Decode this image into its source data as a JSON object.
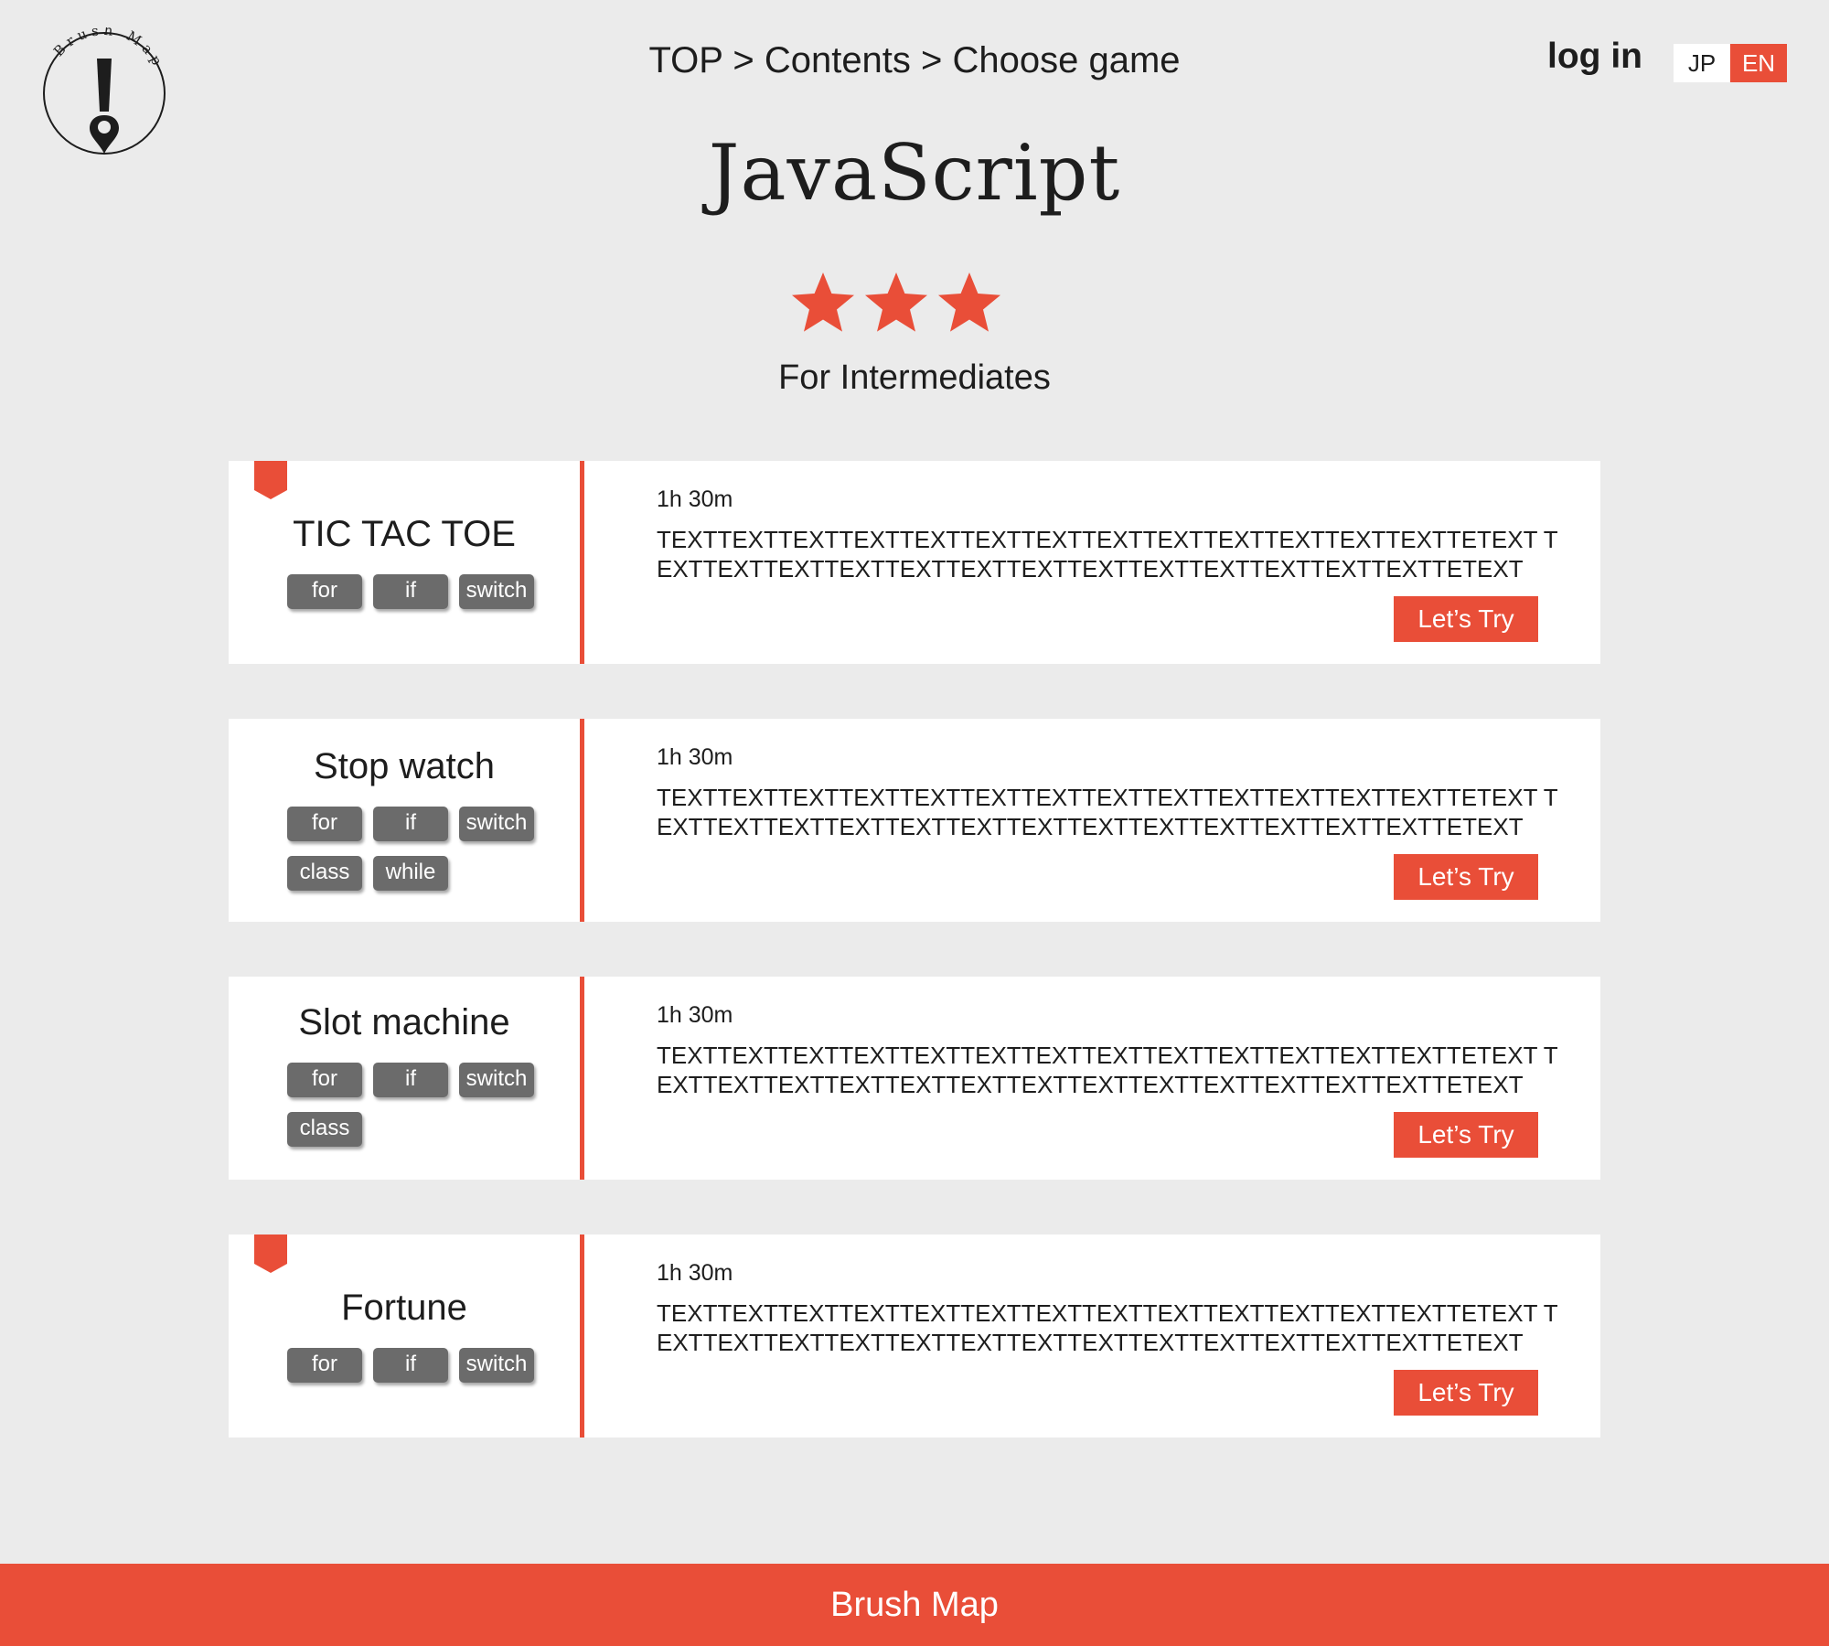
{
  "logo": {
    "brand_text": "Brush Map"
  },
  "header": {
    "breadcrumb": "TOP > Contents > Choose game",
    "login_label": "log in",
    "lang_jp": "JP",
    "lang_en": "EN"
  },
  "course": {
    "title": "JavaScript",
    "rating": {
      "stars": 3,
      "max": 3
    },
    "level": "For Intermediates"
  },
  "games": [
    {
      "title": "TIC TAC TOE",
      "bookmarked": true,
      "tags": [
        "for",
        "if",
        "switch"
      ],
      "duration": "1h 30m",
      "description": "TEXTTEXTTEXTTEXTTEXTTEXTTEXTTEXTTEXTTEXTTEXTTEXTTEXTTETEXT TEXTTEXTTEXTTEXTTEXTTEXTTEXTTEXTTEXTTEXTTEXTTEXTTEXTTETEXT",
      "button": "Let’s Try"
    },
    {
      "title": "Stop watch",
      "bookmarked": false,
      "tags": [
        "for",
        "if",
        "switch",
        "class",
        "while"
      ],
      "duration": "1h 30m",
      "description": "TEXTTEXTTEXTTEXTTEXTTEXTTEXTTEXTTEXTTEXTTEXTTEXTTEXTTETEXT TEXTTEXTTEXTTEXTTEXTTEXTTEXTTEXTTEXTTEXTTEXTTEXTTEXTTETEXT",
      "button": "Let’s Try"
    },
    {
      "title": "Slot machine",
      "bookmarked": false,
      "tags": [
        "for",
        "if",
        "switch",
        "class"
      ],
      "duration": "1h 30m",
      "description": "TEXTTEXTTEXTTEXTTEXTTEXTTEXTTEXTTEXTTEXTTEXTTEXTTEXTTETEXT TEXTTEXTTEXTTEXTTEXTTEXTTEXTTEXTTEXTTEXTTEXTTEXTTEXTTETEXT",
      "button": "Let’s Try"
    },
    {
      "title": "Fortune",
      "bookmarked": true,
      "tags": [
        "for",
        "if",
        "switch"
      ],
      "duration": "1h 30m",
      "description": "TEXTTEXTTEXTTEXTTEXTTEXTTEXTTEXTTEXTTEXTTEXTTEXTTEXTTETEXT TEXTTEXTTEXTTEXTTEXTTEXTTEXTTEXTTEXTTEXTTEXTTEXTTEXTTETEXT",
      "button": "Let’s Try"
    }
  ],
  "footer": {
    "label": "Brush Map"
  },
  "colors": {
    "accent": "#e94e38",
    "background": "#ebebeb",
    "tag": "#6b6b6b",
    "card": "#ffffff"
  }
}
